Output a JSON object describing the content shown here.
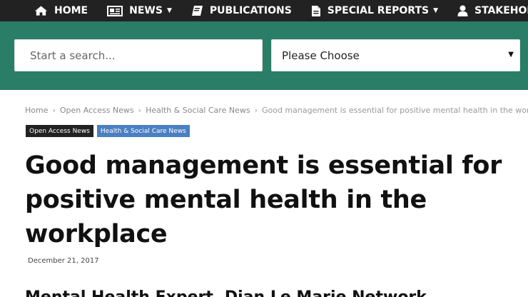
{
  "nav": {
    "items": [
      {
        "label": "HOME",
        "icon": "home-icon",
        "has_caret": false
      },
      {
        "label": "NEWS",
        "icon": "newspaper-icon",
        "has_caret": true
      },
      {
        "label": "PUBLICATIONS",
        "icon": "book-icon",
        "has_caret": false
      },
      {
        "label": "SPECIAL REPORTS",
        "icon": "document-icon",
        "has_caret": true
      },
      {
        "label": "STAKEHOLDERS",
        "icon": "user-icon",
        "has_caret": true
      }
    ],
    "caret": "▼"
  },
  "search": {
    "placeholder": "Start a search...",
    "value": ""
  },
  "select": {
    "value": "Please Choose",
    "arrow": "▼"
  },
  "breadcrumb": {
    "items": [
      "Home",
      "Open Access News",
      "Health & Social Care News",
      "Good management is essential for positive mental health in the workplace"
    ],
    "separator": "›"
  },
  "tags": [
    "Open Access News",
    "Health & Social Care News"
  ],
  "article": {
    "title": "Good management is essential for positive mental health in the workplace",
    "date": "December 21, 2017",
    "subtitle": "Mental Health Expert, Dian Le Marie Network"
  },
  "colors": {
    "nav_bg": "#222222",
    "band_bg": "#2a7d66",
    "tag_blue": "#4a7fc1"
  }
}
